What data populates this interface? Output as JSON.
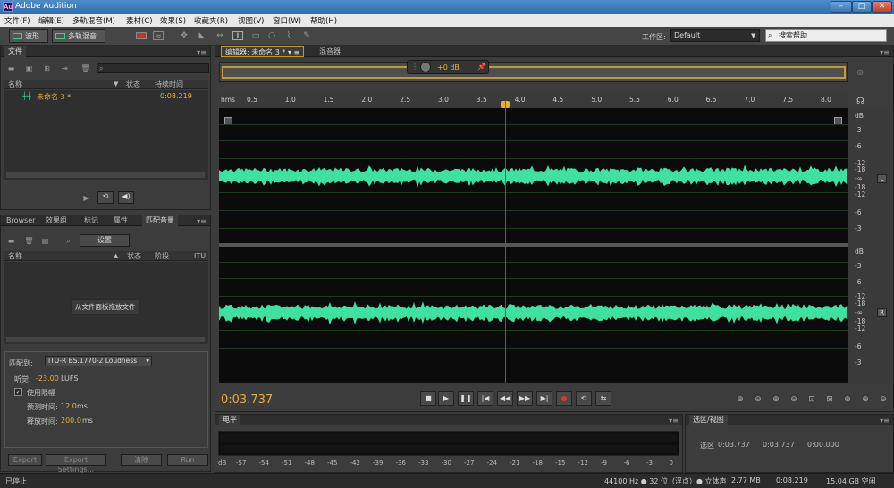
{
  "window": {
    "title": "Adobe Audition",
    "logo": "Au"
  },
  "menu": [
    "文件(F)",
    "编辑(E)",
    "多轨混音(M)",
    "素材(C)",
    "效果(S)",
    "收藏夹(R)",
    "视图(V)",
    "窗口(W)",
    "帮助(H)"
  ],
  "toolbar": {
    "waveform_label": "波形",
    "multitrack_label": "多轨混音",
    "workspace_label": "工作区:",
    "workspace_value": "Default",
    "help_search_placeholder": "搜索帮助"
  },
  "files_panel": {
    "tab": "文件",
    "columns": {
      "name": "名称",
      "status": "状态",
      "duration": "持续时间"
    },
    "items": [
      {
        "name": "未命名 3 *",
        "duration": "0:08.219"
      }
    ]
  },
  "match_panel": {
    "tabs": [
      "Browser",
      "效果组",
      "标记",
      "属性",
      "匹配音量"
    ],
    "settings_button": "设置",
    "columns": {
      "name": "名称",
      "status": "状态",
      "stage": "阶段",
      "itu": "ITU"
    },
    "drop_hint": "从文件面板拖放文件",
    "match_to_label": "匹配到:",
    "match_to_value": "ITU-R BS.1770-2 Loudness",
    "loudness_label": "听觉:",
    "loudness_value": "-23.00",
    "loudness_unit": "LUFS",
    "use_limiter_label": "使用限幅",
    "lookahead_label": "预测时间:",
    "lookahead_value": "12.0",
    "release_label": "释放时间:",
    "release_value": "200.0",
    "ms_unit": "ms",
    "export_button": "Export",
    "export_settings_button": "Export Settings...",
    "clear_button": "清除",
    "run_button": "Run"
  },
  "editor": {
    "tab_label": "编辑器: 未命名 3 *",
    "mixer_tab": "混音器",
    "hud_gain": "+0 dB",
    "ruler_unit": "hms",
    "ruler_ticks": [
      "0.5",
      "1.0",
      "1.5",
      "2.0",
      "2.5",
      "3.0",
      "3.5",
      "4.0",
      "4.5",
      "5.0",
      "5.5",
      "6.0",
      "6.5",
      "7.0",
      "7.5",
      "8.0"
    ],
    "db_unit": "dB",
    "db_ticks": [
      "-3",
      "-6",
      "-12",
      "-18",
      "-∞",
      "-18",
      "-12",
      "-6",
      "-3"
    ],
    "channel_left": "L",
    "channel_right": "R",
    "current_time": "0:03.737",
    "transport": [
      "stop",
      "play",
      "pause",
      "to-start",
      "rewind",
      "fast-forward",
      "to-end",
      "record",
      "loop",
      "skip-selection"
    ]
  },
  "levels": {
    "tab": "电平",
    "scale_unit": "dB",
    "scale": [
      "-57",
      "-54",
      "-51",
      "-48",
      "-45",
      "-42",
      "-39",
      "-36",
      "-33",
      "-30",
      "-27",
      "-24",
      "-21",
      "-18",
      "-15",
      "-12",
      "-9",
      "-6",
      "-3",
      "0"
    ]
  },
  "selection_panel": {
    "tab": "选区/视图",
    "row_label": "选区",
    "start": "0:03.737",
    "end": "0:03.737",
    "duration": "0:00.000"
  },
  "status": {
    "left": "已停止",
    "sample_info": "44100 Hz ● 32 位（浮点）● 立体声",
    "size": "2.77 MB",
    "duration": "0:08.219",
    "free_space": "15.04 GB 空闲"
  },
  "colors": {
    "waveform": "#3fe0a0",
    "accent": "#e8a93a",
    "playhead": "#c0352c"
  }
}
